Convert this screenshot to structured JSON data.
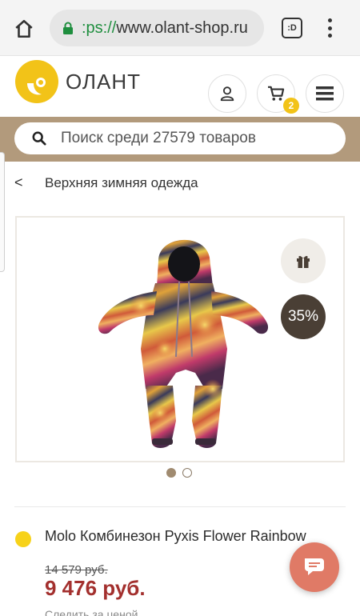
{
  "browser": {
    "url_scheme": ":ps://",
    "url_host": "www.olant-shop.ru",
    "tabs_label": ":D"
  },
  "header": {
    "logo_text": "ОЛАНТ",
    "cart_count": "2",
    "brand_color": "#f2c318"
  },
  "search": {
    "placeholder": "Поиск среди 27579 товаров"
  },
  "breadcrumb": {
    "back_symbol": "<",
    "current": "Верхняя зимняя одежда"
  },
  "product": {
    "discount": "35%",
    "gallery_total": 2,
    "gallery_active": 1,
    "title": "Molo Комбинезон Pyxis Flower Rainbow",
    "old_price": "14 579 руб.",
    "price": "9 476 руб.",
    "watch_price": "Следить за ценой",
    "price_color": "#a3302e"
  },
  "icons": {
    "home": "home-icon",
    "lock": "lock-icon",
    "user": "user-icon",
    "cart": "cart-icon",
    "menu": "hamburger-icon",
    "search": "search-icon",
    "gift": "gift-icon",
    "chat": "chat-icon"
  }
}
